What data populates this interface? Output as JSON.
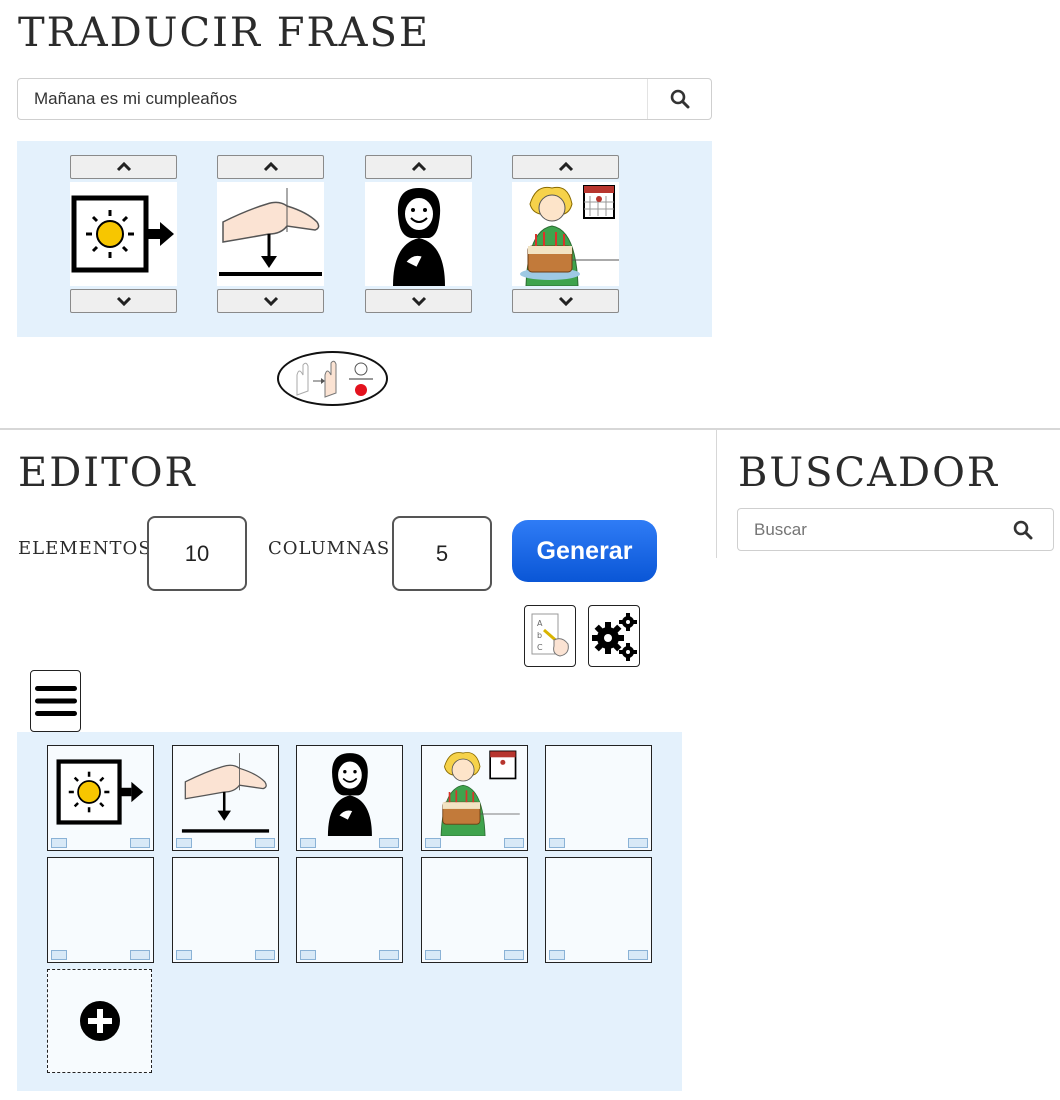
{
  "traducir": {
    "title": "TRADUCIR FRASE",
    "phrase_value": "Mañana es mi cumpleaños",
    "pictograms": [
      {
        "name": "mañana",
        "icon": "sun-arrow-pictogram"
      },
      {
        "name": "es",
        "icon": "hand-down-pictogram"
      },
      {
        "name": "mi",
        "icon": "person-self-pictogram"
      },
      {
        "name": "cumpleaños",
        "icon": "birthday-cake-pictogram"
      }
    ],
    "sign_button_icon": "sign-language-icon"
  },
  "editor": {
    "title": "EDITOR",
    "elementos_label": "ELEMENTOS",
    "elementos_value": "10",
    "columnas_label": "COLUMNAS",
    "columnas_value": "5",
    "generar_label": "Generar",
    "board": {
      "cells": [
        "sun-arrow-pictogram",
        "hand-down-pictogram",
        "person-self-pictogram",
        "birthday-cake-pictogram",
        "",
        "",
        "",
        "",
        "",
        ""
      ]
    }
  },
  "buscador": {
    "title": "BUSCADOR",
    "search_placeholder": "Buscar"
  },
  "colors": {
    "panel_bg": "#e4f1fc",
    "generar_bg": "#1a66e8",
    "divider": "#d7d7d7"
  }
}
